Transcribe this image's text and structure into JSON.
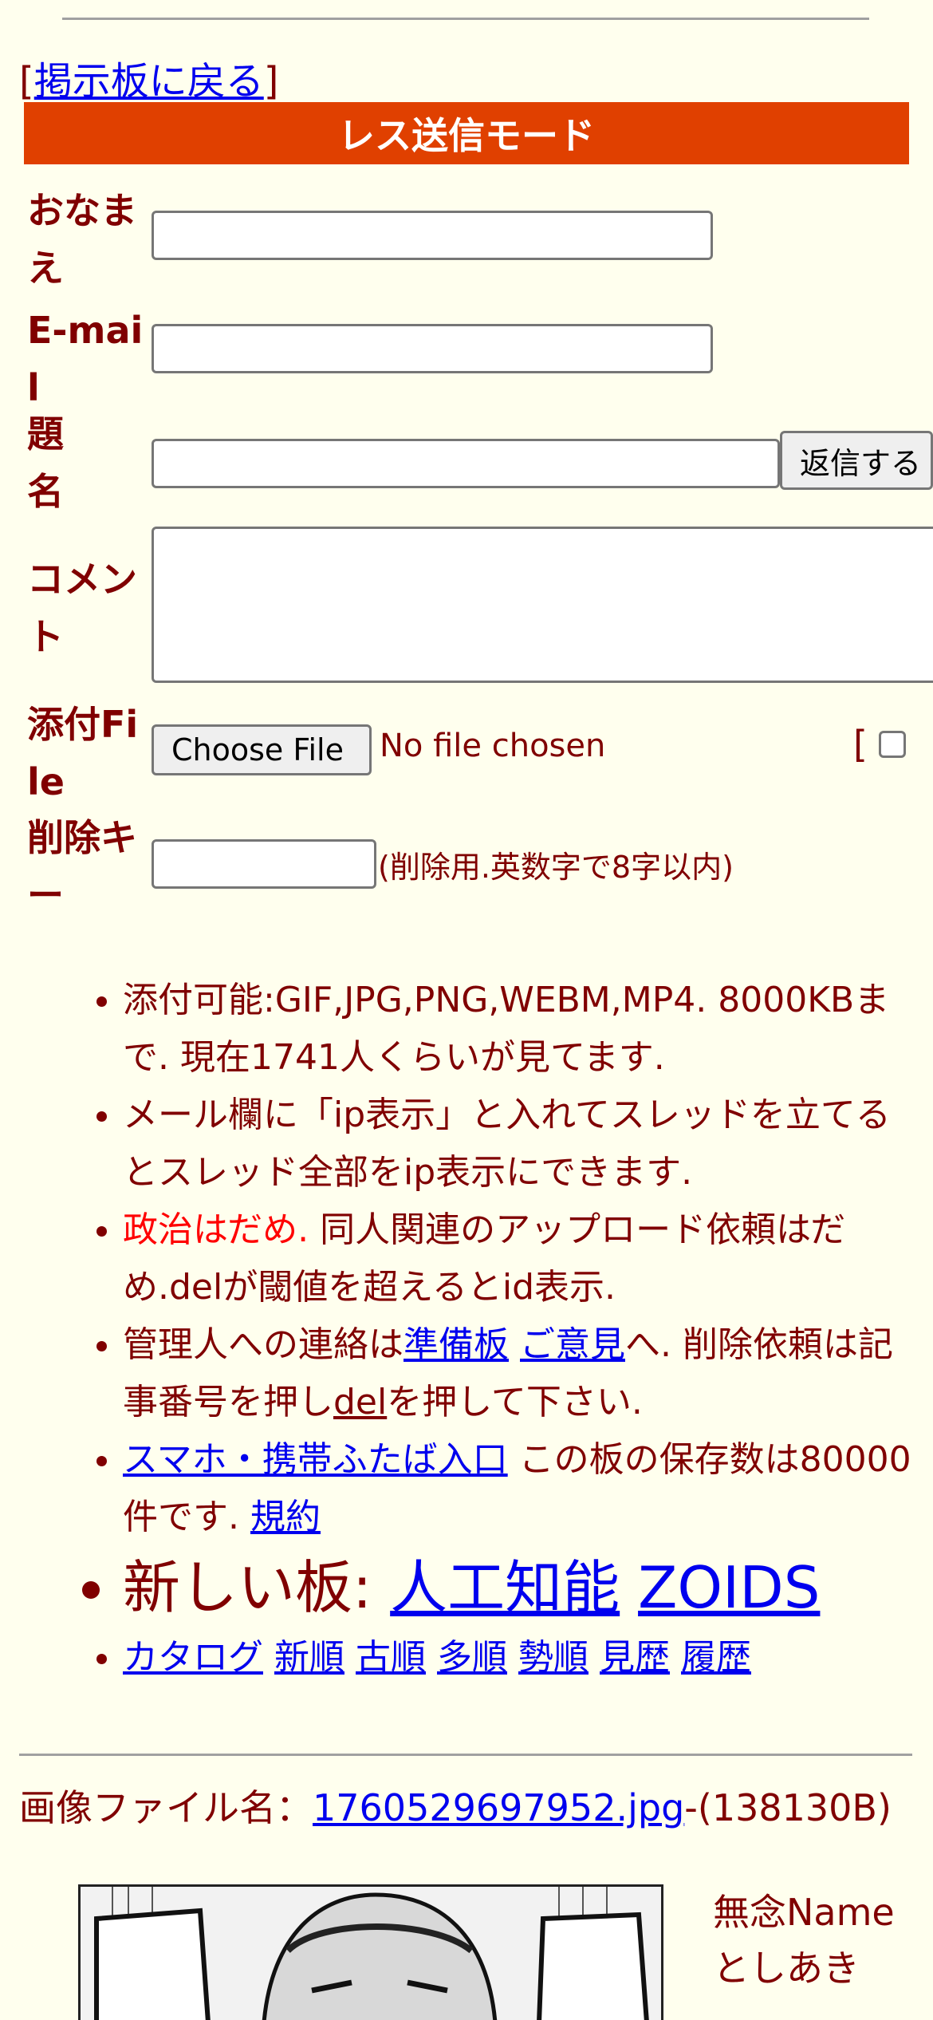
{
  "nav": {
    "bracket_open": "[",
    "back_link": "掲示板に戻る",
    "bracket_close": "]"
  },
  "mode_title": "レス送信モード",
  "form": {
    "name_label": "おなまえ",
    "email_label": "E-mail",
    "subject_label": "題名",
    "submit_label": "返信する",
    "comment_label": "コメント",
    "file_label": "添付File",
    "choose_file_label": "Choose File",
    "no_file_text": "No file chosen",
    "image_option_text": "[",
    "delkey_label": "削除キー",
    "delkey_hint": "(削除用.英数字で8字以内)"
  },
  "notes": {
    "n1": "添付可能:GIF,JPG,PNG,WEBM,MP4. 8000KBまで. 現在1741人くらいが見てます.",
    "n2": "メール欄に「ip表示」と入れてスレッドを立てるとスレッド全部をip表示にできます.",
    "n3_red": "政治はだめ.",
    "n3_rest": " 同人関連のアップロード依頼はだめ.delが閾値を超えるとid表示.",
    "n4_a": "管理人への連絡は",
    "n4_link1": "準備板",
    "n4_link2": "ご意見",
    "n4_b": "へ. 削除依頼は記事番号を押し",
    "n4_del": "del",
    "n4_c": "を押して下さい.",
    "n5_link": "スマホ・携帯ふたば入口",
    "n5_text": " この板の保存数は80000件です. ",
    "n5_rules": "規約",
    "n6_text": "新しい板: ",
    "n6_link1": "人工知能",
    "n6_link2": "ZOIDS",
    "sort_links": [
      "カタログ",
      "新順",
      "古順",
      "多順",
      "勢順",
      "見歴",
      "履歴"
    ]
  },
  "post": {
    "file_prefix": "画像ファイル名：",
    "file_name": "1760529697952.jpg",
    "file_size": "-(138130B)",
    "name_line": "無念Name",
    "poster_name": "としあき"
  }
}
